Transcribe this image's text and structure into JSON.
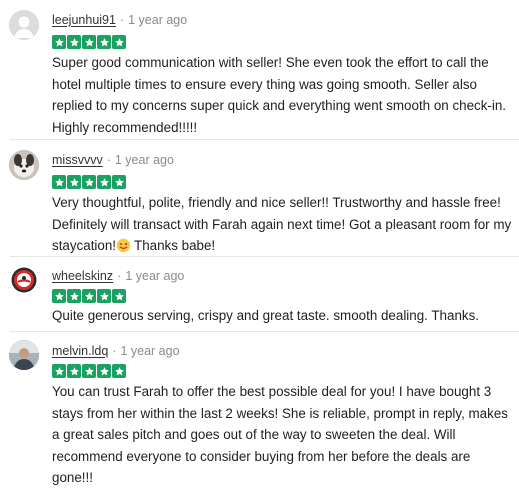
{
  "reviews": [
    {
      "username": "leejunhui91",
      "time": "1 year ago",
      "separator": "·",
      "rating": 5,
      "text": "Super good communication with seller! She even took the effort to call the hotel multiple times to ensure every thing was going smooth. Seller also replied to my concerns super quick and everything went smooth on check-in. Highly recommended!!!!!",
      "avatar_icon": "default-user-avatar"
    },
    {
      "username": "missvvvv",
      "time": "1 year ago",
      "separator": "·",
      "rating": 5,
      "text_before_emoji": "Very thoughtful, polite, friendly and nice seller!! Trustworthy and hassle free! Definitely will transact with Farah again next time! Got a pleasant room for my staycation!",
      "emoji": "tongue-out-face",
      "text_after_emoji": "Thanks babe!",
      "avatar_icon": "dog-photo-avatar"
    },
    {
      "username": "wheelskinz",
      "time": "1 year ago",
      "separator": "·",
      "rating": 5,
      "text": "Quite generous serving, crispy and great taste. smooth dealing. Thanks.",
      "avatar_icon": "wheel-logo-avatar"
    },
    {
      "username": "melvin.ldq",
      "time": "1 year ago",
      "separator": "·",
      "rating": 5,
      "text": "You can trust Farah to offer the best possible deal for you! I have bought 3 stays from her within the last 2 weeks! She is reliable, prompt in reply, makes a great sales pitch and goes out of the way to sweeten the deal. Will recommend everyone to consider buying from her before the deals are gone!!!",
      "avatar_icon": "person-photo-avatar"
    }
  ],
  "colors": {
    "star_green": "#1aa260",
    "text": "#1f1f1f",
    "meta": "#8a8a8a"
  }
}
